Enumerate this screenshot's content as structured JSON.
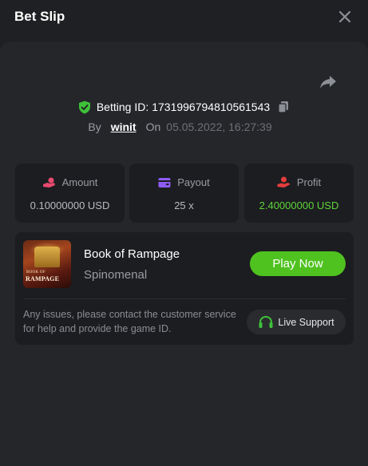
{
  "header": {
    "title": "Bet Slip"
  },
  "bet": {
    "betting_id_label": "Betting ID:",
    "betting_id": "1731996794810561543",
    "by_label": "By",
    "username": "winit",
    "on_label": "On",
    "datetime": "05.05.2022, 16:27:39"
  },
  "stats": [
    {
      "icon": "coin-hand-icon",
      "label": "Amount",
      "value": "0.10000000 USD",
      "icon_color": "#e84a6f"
    },
    {
      "icon": "wallet-icon",
      "label": "Payout",
      "value": "25 x",
      "icon_color": "#8e5cf4"
    },
    {
      "icon": "hand-money-icon",
      "label": "Profit",
      "value": "2.40000000 USD",
      "icon_color": "#e53d3d",
      "value_color": "#5ed43a"
    }
  ],
  "game": {
    "name": "Book of Rampage",
    "provider": "Spinomenal",
    "thumb_text_small": "BOOK OF",
    "thumb_text_big": "RAMPAGE",
    "play_label": "Play Now"
  },
  "support": {
    "issues_text": "Any issues, please contact the customer service for help and provide the game ID.",
    "button_label": "Live Support"
  },
  "colors": {
    "background": "#1f2023",
    "panel": "#25262a",
    "card": "#1c1d20",
    "accent_green": "#4fc21f",
    "profit_green": "#5ed43a",
    "shield_green": "#3ec13a"
  }
}
